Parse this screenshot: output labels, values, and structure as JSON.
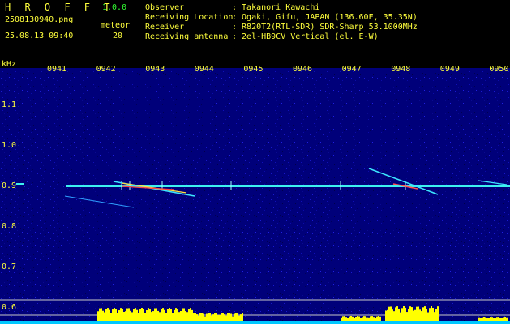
{
  "header": {
    "app_name": "H R O F F T",
    "version": "1.0.0",
    "filename": "2508130940.png",
    "mode_label": "meteor",
    "datetime": "25.08.13 09:40",
    "count": "20",
    "fields": [
      {
        "label": "Observer",
        "value": ": Takanori Kawachi"
      },
      {
        "label": "Receiving Location",
        "value": ": Ogaki, Gifu, JAPAN (136.60E, 35.35N)"
      },
      {
        "label": "Receiver",
        "value": ": R820T2(RTL-SDR) SDR-Sharp 53.1000MHz"
      },
      {
        "label": "Receiving antenna",
        "value": ": 2el-HB9CV Vertical (el. E-W)"
      }
    ]
  },
  "spectrogram": {
    "y_unit": "kHz",
    "time_ticks": [
      "0941",
      "0942",
      "0943",
      "0944",
      "0945",
      "0946",
      "0947",
      "0948",
      "0949",
      "0950"
    ],
    "freq_ticks": [
      "1.1",
      "1.0",
      "0.9",
      "0.8",
      "0.7",
      "0.6"
    ],
    "carrier_freq_khz": 0.9,
    "colors": {
      "background": "#000080",
      "axis_text": "#ffff3c",
      "carrier": "#3cf0f0",
      "activity_fill": "#ffff00",
      "bottom_band": "#00c8ff"
    }
  }
}
